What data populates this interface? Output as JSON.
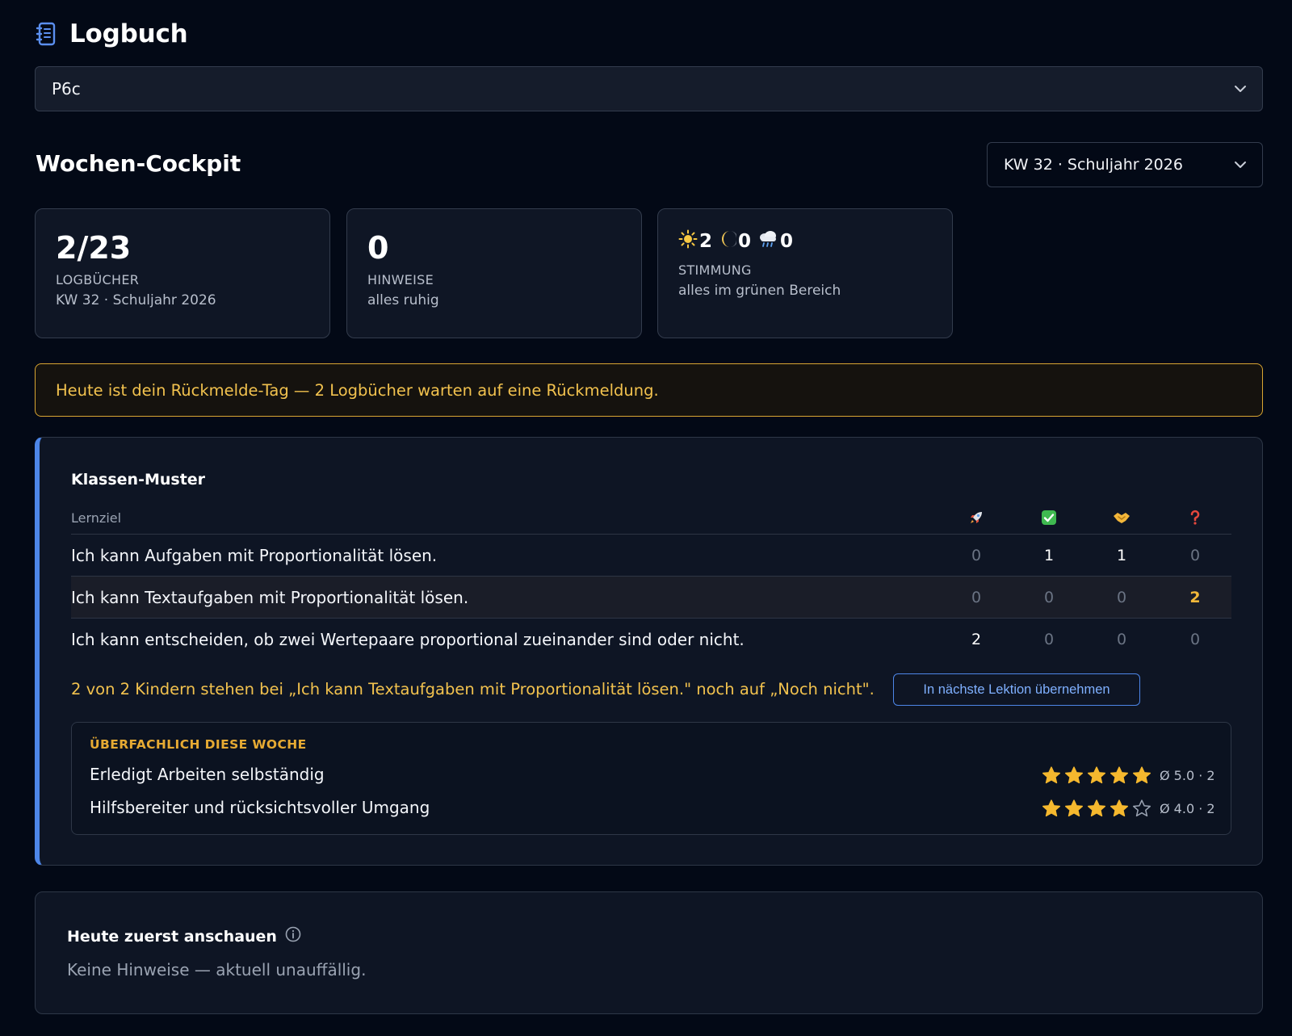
{
  "header": {
    "title": "Logbuch",
    "icon": "notebook-icon"
  },
  "class_select": {
    "value": "P6c",
    "icon": "chevron-down-icon"
  },
  "cockpit": {
    "title": "Wochen-Cockpit",
    "week_select": {
      "value": "KW 32 · Schuljahr 2026"
    }
  },
  "stats": [
    {
      "value": "2/23",
      "label": "LOGBÜCHER",
      "sub": "KW 32 · Schuljahr 2026"
    },
    {
      "value": "0",
      "label": "HINWEISE",
      "sub": "alles ruhig"
    },
    {
      "mood": [
        {
          "icon": "sun-icon",
          "count": "2"
        },
        {
          "icon": "moon-icon",
          "count": "0"
        },
        {
          "icon": "rain-cloud-icon",
          "count": "0"
        }
      ],
      "label": "STIMMUNG",
      "sub": "alles im grünen Bereich"
    }
  ],
  "banner": {
    "text": "Heute ist dein Rückmelde-Tag — 2 Logbücher warten auf eine Rückmeldung."
  },
  "klassen_muster": {
    "title": "Klassen-Muster",
    "column_header": "Lernziel",
    "column_icons": [
      "rocket-icon",
      "check-icon",
      "handshake-icon",
      "question-icon"
    ],
    "rows": [
      {
        "goal": "Ich kann Aufgaben mit Proportionalität lösen.",
        "values": [
          "0",
          "1",
          "1",
          "0"
        ]
      },
      {
        "goal": "Ich kann Textaufgaben mit Proportionalität lösen.",
        "values": [
          "0",
          "0",
          "0",
          "2"
        ]
      },
      {
        "goal": "Ich kann entscheiden, ob zwei Wertepaare proportional zueinander sind oder nicht.",
        "values": [
          "2",
          "0",
          "0",
          "0"
        ]
      }
    ],
    "hint": "2 von 2 Kindern stehen bei „Ich kann Textaufgaben mit Proportionalität lösen.\" noch auf „Noch nicht\".",
    "adopt_button": "In nächste Lektion übernehmen",
    "ueberfachlich": {
      "title": "ÜBERFACHLICH DIESE WOCHE",
      "items": [
        {
          "label": "Erledigt Arbeiten selbständig",
          "rating": 5,
          "max": 5,
          "summary": "Ø 5.0 · 2"
        },
        {
          "label": "Hilfsbereiter und rücksichtsvoller Umgang",
          "rating": 4,
          "max": 5,
          "summary": "Ø 4.0 · 2"
        }
      ]
    }
  },
  "heute": {
    "title": "Heute zuerst anschauen",
    "info_icon": "info-icon",
    "text": "Keine Hinweise — aktuell unauffällig."
  },
  "colors": {
    "background": "#030916",
    "accent_blue": "#4d86e8",
    "warning": "#f2c24e",
    "star": "#f5b82e"
  }
}
